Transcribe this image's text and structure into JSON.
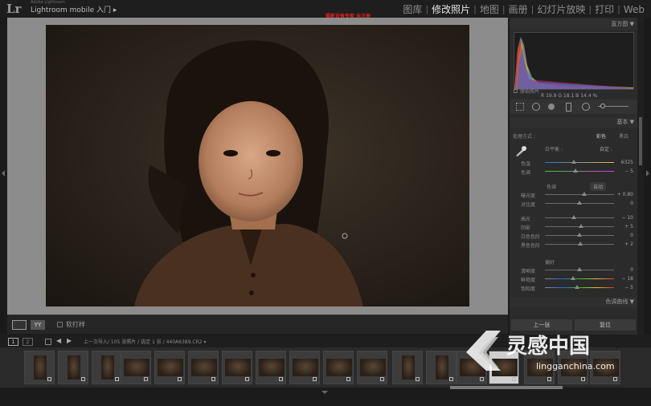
{
  "topbar": {
    "logo": "Lr",
    "brand_small": "Adobe Lightroom",
    "brand": "Lightroom mobile 入门 ▸",
    "red_text": "摄影设备专家 未注册",
    "modules": [
      "图库",
      "修改照片",
      "地图",
      "画册",
      "幻灯片放映",
      "打印",
      "Web"
    ],
    "active_module": "修改照片"
  },
  "histogram": {
    "title": "直方图 ▼",
    "readout": "R 19.9  G 18.1  B 14.4 %",
    "original_label": "原始照片"
  },
  "basic": {
    "title": "基本 ▼",
    "treatment_label": "处理方式 :",
    "color_opt": "彩色",
    "bw_opt": "黑白",
    "wb_label": "白平衡 :",
    "wb_value": "自定 :",
    "temp_label": "色温",
    "temp_value": "6325",
    "tint_label": "色调",
    "tint_value": "− 5",
    "tone_label": "色调",
    "auto_label": "自动",
    "exposure_label": "曝光度",
    "exposure_value": "+ 0.80",
    "contrast_label": "对比度",
    "contrast_value": "0",
    "highlights_label": "高光",
    "highlights_value": "− 10",
    "shadows_label": "阴影",
    "shadows_value": "+ 5",
    "whites_label": "白色色阶",
    "whites_value": "0",
    "blacks_label": "黑色色阶",
    "blacks_value": "+ 2",
    "presence_label": "偏好",
    "clarity_label": "清晰度",
    "clarity_value": "0",
    "vibrance_label": "鲜艳度",
    "vibrance_value": "− 18",
    "saturation_label": "饱和度",
    "saturation_value": "− 5"
  },
  "tone_curve": {
    "title": "色调曲线 ▼"
  },
  "buttons": {
    "prev": "上一张",
    "reset": "复位"
  },
  "toolbar": {
    "softproof_label": "软打样"
  },
  "filmstrip": {
    "page1": "1",
    "page2": "2",
    "path": "上一次导入/   105 张照片 / 选定 1 张 / 440A6389.CR2 ▾",
    "thumb_count": 18
  },
  "watermark": {
    "brand_cn": "灵感中国",
    "brand_url": "lingganchina.com"
  }
}
